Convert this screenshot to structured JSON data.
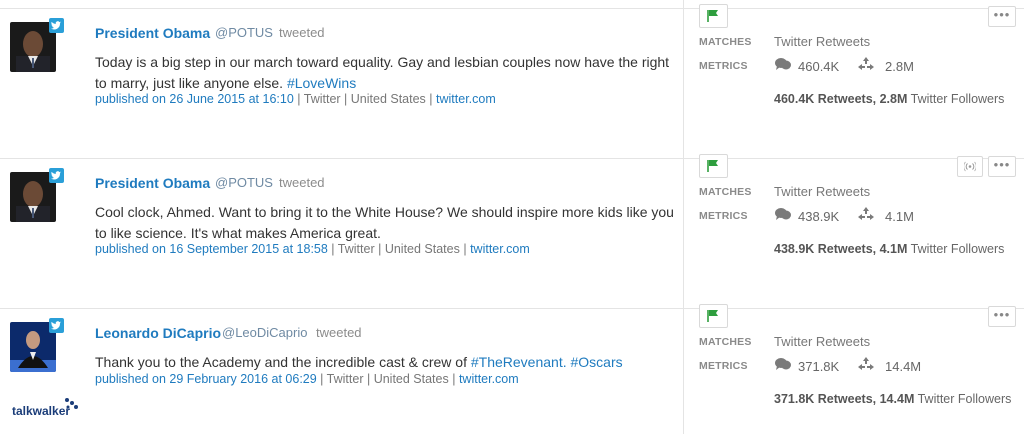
{
  "posts": [
    {
      "name": "President Obama",
      "handle": "@POTUS",
      "action": "tweeted",
      "text_plain": "Today is a big step in our march toward equality. Gay and lesbian couples now have the right to marry, just like anyone else. ",
      "hashtags": "#LoveWins",
      "published": "published on 26 June 2015 at 16:10",
      "source": "Twitter",
      "country": "United States",
      "link": "twitter.com",
      "matches_label": "MATCHES",
      "match_value": "Twitter Retweets",
      "metrics_label": "METRICS",
      "retweets": "460.4K",
      "followers": "2.8M",
      "summary_bold": "460.4K Retweets, 2.8M",
      "summary_rest": " Twitter Followers"
    },
    {
      "name": "President Obama",
      "handle": "@POTUS",
      "action": "tweeted",
      "text_plain": "Cool clock, Ahmed. Want to bring it to the White House? We should inspire more kids like you to like science. It's what makes America great.",
      "hashtags": "",
      "published": "published on 16 September 2015 at 18:58",
      "source": "Twitter",
      "country": "United States",
      "link": "twitter.com",
      "matches_label": "MATCHES",
      "match_value": "Twitter Retweets",
      "metrics_label": "METRICS",
      "retweets": "438.9K",
      "followers": "4.1M",
      "summary_bold": "438.9K Retweets, 4.1M",
      "summary_rest": " Twitter Followers"
    },
    {
      "name": "Leonardo DiCaprio",
      "handle": "@LeoDiCaprio",
      "action": "tweeted",
      "text_plain": "Thank you to the Academy and the incredible cast & crew of ",
      "hashtags": "#TheRevenant. #Oscars",
      "published": "published on 29 February 2016 at 06:29",
      "source": "Twitter",
      "country": "United States",
      "link": "twitter.com",
      "matches_label": "MATCHES",
      "match_value": "Twitter Retweets",
      "metrics_label": "METRICS",
      "retweets": "371.8K",
      "followers": "14.4M",
      "summary_bold": "371.8K Retweets, 14.4M",
      "summary_rest": " Twitter Followers"
    }
  ],
  "more_label": "•••",
  "logo": "talkwalker",
  "colors": {
    "link": "#1f7bbf",
    "flag": "#2e9e3e",
    "twitter": "#2a9fd8"
  }
}
